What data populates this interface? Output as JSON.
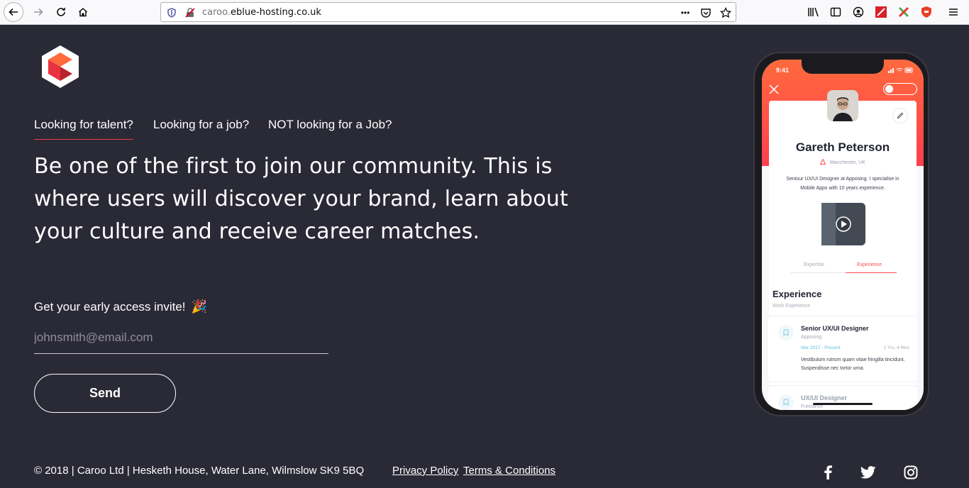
{
  "browser": {
    "url_prefix": "caroo.",
    "url_domain": "eblue-hosting.co.uk",
    "url_more": "•••"
  },
  "page": {
    "tabs": [
      {
        "label": "Looking for talent?",
        "active": true
      },
      {
        "label": "Looking for a job?",
        "active": false
      },
      {
        "label": "NOT looking for a Job?",
        "active": false
      }
    ],
    "headline": "Be one of the first to join our community. This is where users will discover your brand, learn about your culture and receive career matches.",
    "invite_label": "Get your early access invite!",
    "invite_emoji": "🎉",
    "email_placeholder": "johnsmith@email.com",
    "send_label": "Send",
    "footer_copyright": "© 2018 | Caroo Ltd | Hesketh House, Water Lane, Wilmslow SK9 5BQ",
    "privacy_label": "Privacy Policy",
    "terms_label": "Terms & Conditions",
    "accent_color": "#e8404a"
  },
  "phone": {
    "time": "9:41",
    "name": "Gareth Peterson",
    "location": "Manchester, UK",
    "bio": "Seniour UX/UI Designer at Apposing. I specialise in Mobile Apps with 10 years experience.",
    "tabs": [
      "Expertise",
      "Experience"
    ],
    "experience_title": "Experience",
    "experience_sub": "Work Experience",
    "jobs": [
      {
        "title": "Senior UX/UI Designer",
        "company": "Apposing",
        "dates": "Mar 2017 - Present",
        "duration": "1 Yrs, 4 Mos",
        "description": "Vestibulum rutrum quam vitae fringilla tincidunt. Suspendisse nec tortor urna."
      },
      {
        "title": "UX/UI Designer",
        "company": "Freelance"
      }
    ]
  }
}
